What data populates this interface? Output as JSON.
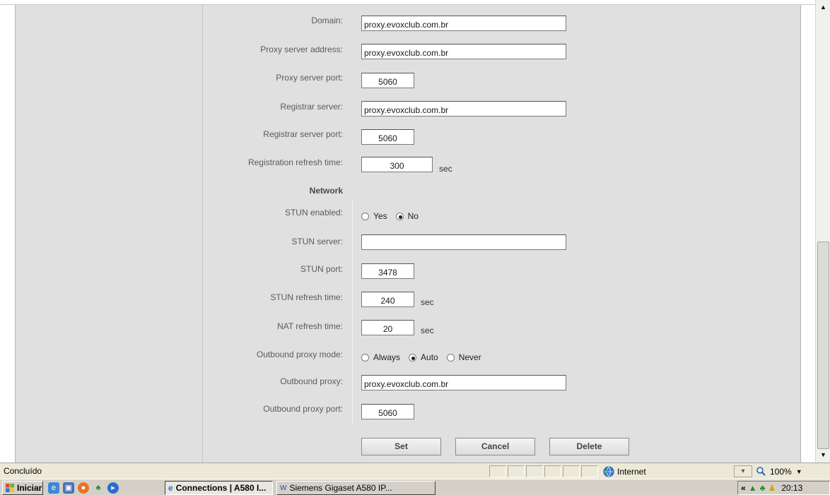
{
  "form": {
    "rows": [
      {
        "label": "Domain:",
        "value": "proxy.evoxclub.com.br"
      },
      {
        "label": "Proxy server address:",
        "value": "proxy.evoxclub.com.br"
      },
      {
        "label": "Proxy server port:",
        "value": "5060"
      },
      {
        "label": "Registrar server:",
        "value": "proxy.evoxclub.com.br"
      },
      {
        "label": "Registrar server port:",
        "value": "5060"
      },
      {
        "label": "Registration refresh time:",
        "value": "300",
        "unit": "sec"
      }
    ],
    "network_heading": "Network",
    "stun_enabled": {
      "label": "STUN enabled:",
      "options": [
        "Yes",
        "No"
      ],
      "selected": "No"
    },
    "stun_server": {
      "label": "STUN server:",
      "value": ""
    },
    "stun_port": {
      "label": "STUN port:",
      "value": "3478"
    },
    "stun_refresh": {
      "label": "STUN refresh time:",
      "value": "240",
      "unit": "sec"
    },
    "nat_refresh": {
      "label": "NAT refresh time:",
      "value": "20",
      "unit": "sec"
    },
    "outbound_mode": {
      "label": "Outbound proxy mode:",
      "options": [
        "Always",
        "Auto",
        "Never"
      ],
      "selected": "Auto"
    },
    "outbound_proxy": {
      "label": "Outbound proxy:",
      "value": "proxy.evoxclub.com.br"
    },
    "outbound_port": {
      "label": "Outbound proxy port:",
      "value": "5060"
    },
    "buttons": {
      "set": "Set",
      "cancel": "Cancel",
      "delete": "Delete"
    }
  },
  "statusbar": {
    "status": "Concluído",
    "zone": "Internet",
    "zoom": "100%"
  },
  "taskbar": {
    "start": "Iniciar",
    "tasks": [
      "Connections | A580 I...",
      "Siemens Gigaset A580 IP..."
    ],
    "clock": "20:13"
  },
  "colors": {
    "form_bg": "#e0e0e0",
    "taskbar_bg": "#d4d0c8",
    "status_bg": "#ece9d8"
  }
}
